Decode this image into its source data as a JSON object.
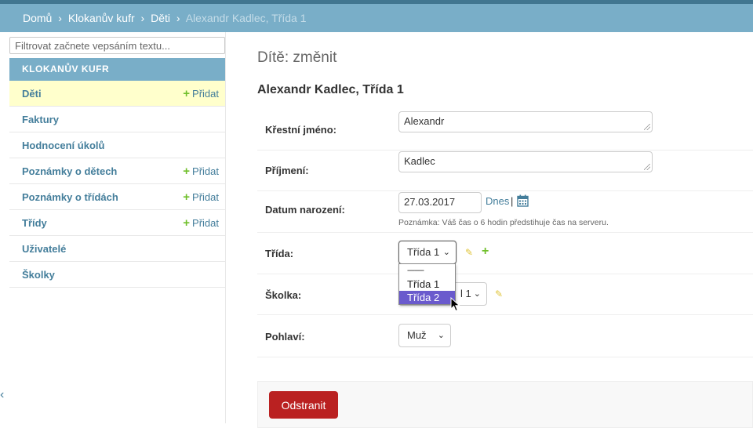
{
  "breadcrumbs": {
    "home": "Domů",
    "app": "Klokanův kufr",
    "model": "Děti",
    "current": "Alexandr Kadlec, Třída 1",
    "sep": "›"
  },
  "sidebar": {
    "filter_placeholder": "Filtrovat začnete vepsáním textu...",
    "module_title": "Klokanův kufr",
    "add_label": "Přidat",
    "items": [
      {
        "label": "Děti",
        "add": true,
        "active": true
      },
      {
        "label": "Faktury",
        "add": false
      },
      {
        "label": "Hodnocení úkolů",
        "add": false
      },
      {
        "label": "Poznámky o dětech",
        "add": true
      },
      {
        "label": "Poznámky o třídách",
        "add": true
      },
      {
        "label": "Třídy",
        "add": true
      },
      {
        "label": "Uživatelé",
        "add": false
      },
      {
        "label": "Školky",
        "add": false
      }
    ],
    "collapse_glyph": "‹"
  },
  "page": {
    "title": "Dítě: změnit",
    "object": "Alexandr Kadlec, Třída 1"
  },
  "form": {
    "first_name": {
      "label": "Křestní jméno:",
      "value": "Alexandr"
    },
    "last_name": {
      "label": "Příjmení:",
      "value": "Kadlec"
    },
    "birth_date": {
      "label": "Datum narození:",
      "value": "27.03.2017",
      "today": "Dnes",
      "separator": "|",
      "help": "Poznámka: Váš čas o 6 hodin předstihuje čas na serveru."
    },
    "class": {
      "label": "Třída:",
      "value": "Třída 1",
      "options": [
        "---------",
        "Třída 1",
        "Třída 2"
      ],
      "highlighted": "Třída 2"
    },
    "school": {
      "label": "Školka:",
      "value_partial": "l 1"
    },
    "gender": {
      "label": "Pohlaví:",
      "value": "Muž"
    }
  },
  "actions": {
    "delete": "Odstranit"
  },
  "colors": {
    "accent": "#79aec8",
    "header": "#417690",
    "delete": "#ba2121",
    "add_green": "#70bf2b"
  }
}
